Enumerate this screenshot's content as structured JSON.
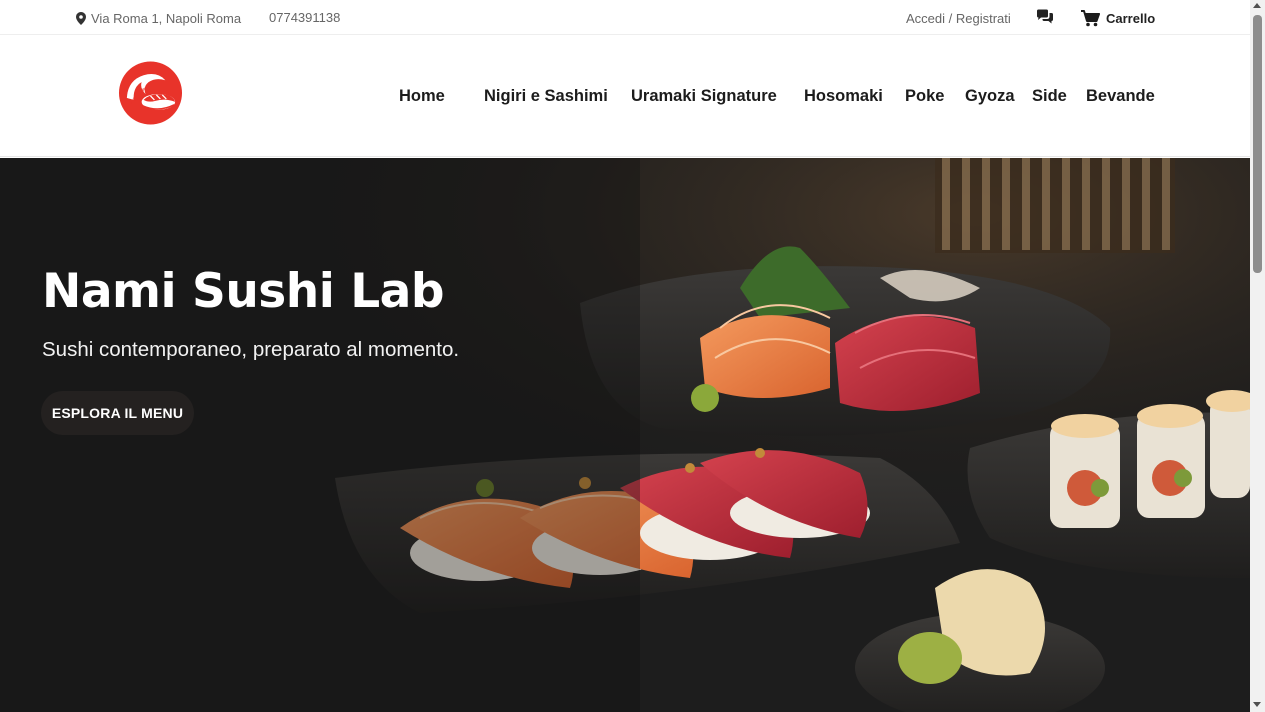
{
  "topbar": {
    "address": "Via Roma 1, Napoli Roma",
    "phone": "0774391138",
    "login": "Accedi / Registrati",
    "cart": "Carrello"
  },
  "nav": {
    "items": [
      "Home",
      "Nigiri e Sashimi",
      "Uramaki Signature",
      "Hosomaki",
      "Poke",
      "Gyoza",
      "Side",
      "Bevande"
    ]
  },
  "hero": {
    "title": "Nami Sushi Lab",
    "subtitle": "Sushi contemporaneo, preparato al momento.",
    "cta": "ESPLORA IL MENU"
  },
  "icons": {
    "location": "map-pin-icon",
    "chat": "chat-bubbles-icon",
    "cart": "shopping-cart-icon",
    "logo": "wave-sushi-logo"
  },
  "colors": {
    "brand_red": "#e8332a",
    "hero_dark": "#1a1a1a",
    "text_dark": "#1c1c1c"
  }
}
